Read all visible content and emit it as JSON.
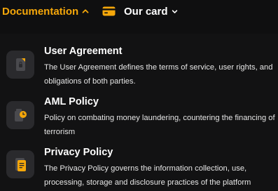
{
  "nav": {
    "documentation_label": "Documentation",
    "documentation_chevron_icon": "chevron-up-icon",
    "our_card_label": "Our card",
    "our_card_icon": "credit-card-icon",
    "our_card_chevron_icon": "chevron-down-icon"
  },
  "colors": {
    "accent": "#f5a70a",
    "background": "#0f0f10",
    "tile": "#2a2a2d"
  },
  "menu": {
    "items": [
      {
        "title": "User Agreement",
        "description": "The User Agreement defines the terms of service, user rights, and obligations of both parties.",
        "icon": "document-lock-icon"
      },
      {
        "title": "AML Policy",
        "description": "Policy on combating money laundering, countering the financing of terrorism",
        "icon": "document-clock-icon"
      },
      {
        "title": "Privacy Policy",
        "description": "The Privacy Policy governs the information collection, use, processing, storage and disclosure practices of the platform",
        "icon": "privacy-document-icon"
      }
    ]
  }
}
